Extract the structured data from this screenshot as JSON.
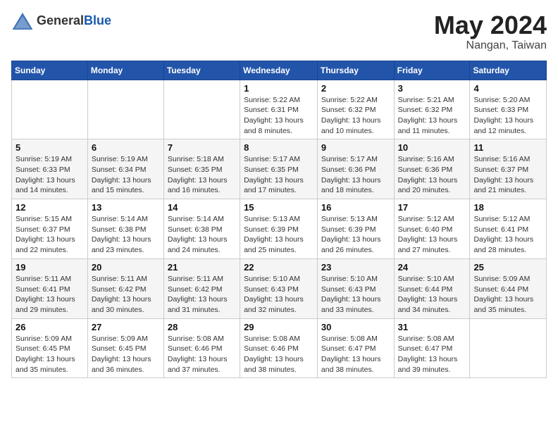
{
  "header": {
    "logo_general": "General",
    "logo_blue": "Blue",
    "month": "May 2024",
    "location": "Nangan, Taiwan"
  },
  "weekdays": [
    "Sunday",
    "Monday",
    "Tuesday",
    "Wednesday",
    "Thursday",
    "Friday",
    "Saturday"
  ],
  "weeks": [
    [
      {
        "day": "",
        "info": ""
      },
      {
        "day": "",
        "info": ""
      },
      {
        "day": "",
        "info": ""
      },
      {
        "day": "1",
        "info": "Sunrise: 5:22 AM\nSunset: 6:31 PM\nDaylight: 13 hours\nand 8 minutes."
      },
      {
        "day": "2",
        "info": "Sunrise: 5:22 AM\nSunset: 6:32 PM\nDaylight: 13 hours\nand 10 minutes."
      },
      {
        "day": "3",
        "info": "Sunrise: 5:21 AM\nSunset: 6:32 PM\nDaylight: 13 hours\nand 11 minutes."
      },
      {
        "day": "4",
        "info": "Sunrise: 5:20 AM\nSunset: 6:33 PM\nDaylight: 13 hours\nand 12 minutes."
      }
    ],
    [
      {
        "day": "5",
        "info": "Sunrise: 5:19 AM\nSunset: 6:33 PM\nDaylight: 13 hours\nand 14 minutes."
      },
      {
        "day": "6",
        "info": "Sunrise: 5:19 AM\nSunset: 6:34 PM\nDaylight: 13 hours\nand 15 minutes."
      },
      {
        "day": "7",
        "info": "Sunrise: 5:18 AM\nSunset: 6:35 PM\nDaylight: 13 hours\nand 16 minutes."
      },
      {
        "day": "8",
        "info": "Sunrise: 5:17 AM\nSunset: 6:35 PM\nDaylight: 13 hours\nand 17 minutes."
      },
      {
        "day": "9",
        "info": "Sunrise: 5:17 AM\nSunset: 6:36 PM\nDaylight: 13 hours\nand 18 minutes."
      },
      {
        "day": "10",
        "info": "Sunrise: 5:16 AM\nSunset: 6:36 PM\nDaylight: 13 hours\nand 20 minutes."
      },
      {
        "day": "11",
        "info": "Sunrise: 5:16 AM\nSunset: 6:37 PM\nDaylight: 13 hours\nand 21 minutes."
      }
    ],
    [
      {
        "day": "12",
        "info": "Sunrise: 5:15 AM\nSunset: 6:37 PM\nDaylight: 13 hours\nand 22 minutes."
      },
      {
        "day": "13",
        "info": "Sunrise: 5:14 AM\nSunset: 6:38 PM\nDaylight: 13 hours\nand 23 minutes."
      },
      {
        "day": "14",
        "info": "Sunrise: 5:14 AM\nSunset: 6:38 PM\nDaylight: 13 hours\nand 24 minutes."
      },
      {
        "day": "15",
        "info": "Sunrise: 5:13 AM\nSunset: 6:39 PM\nDaylight: 13 hours\nand 25 minutes."
      },
      {
        "day": "16",
        "info": "Sunrise: 5:13 AM\nSunset: 6:39 PM\nDaylight: 13 hours\nand 26 minutes."
      },
      {
        "day": "17",
        "info": "Sunrise: 5:12 AM\nSunset: 6:40 PM\nDaylight: 13 hours\nand 27 minutes."
      },
      {
        "day": "18",
        "info": "Sunrise: 5:12 AM\nSunset: 6:41 PM\nDaylight: 13 hours\nand 28 minutes."
      }
    ],
    [
      {
        "day": "19",
        "info": "Sunrise: 5:11 AM\nSunset: 6:41 PM\nDaylight: 13 hours\nand 29 minutes."
      },
      {
        "day": "20",
        "info": "Sunrise: 5:11 AM\nSunset: 6:42 PM\nDaylight: 13 hours\nand 30 minutes."
      },
      {
        "day": "21",
        "info": "Sunrise: 5:11 AM\nSunset: 6:42 PM\nDaylight: 13 hours\nand 31 minutes."
      },
      {
        "day": "22",
        "info": "Sunrise: 5:10 AM\nSunset: 6:43 PM\nDaylight: 13 hours\nand 32 minutes."
      },
      {
        "day": "23",
        "info": "Sunrise: 5:10 AM\nSunset: 6:43 PM\nDaylight: 13 hours\nand 33 minutes."
      },
      {
        "day": "24",
        "info": "Sunrise: 5:10 AM\nSunset: 6:44 PM\nDaylight: 13 hours\nand 34 minutes."
      },
      {
        "day": "25",
        "info": "Sunrise: 5:09 AM\nSunset: 6:44 PM\nDaylight: 13 hours\nand 35 minutes."
      }
    ],
    [
      {
        "day": "26",
        "info": "Sunrise: 5:09 AM\nSunset: 6:45 PM\nDaylight: 13 hours\nand 35 minutes."
      },
      {
        "day": "27",
        "info": "Sunrise: 5:09 AM\nSunset: 6:45 PM\nDaylight: 13 hours\nand 36 minutes."
      },
      {
        "day": "28",
        "info": "Sunrise: 5:08 AM\nSunset: 6:46 PM\nDaylight: 13 hours\nand 37 minutes."
      },
      {
        "day": "29",
        "info": "Sunrise: 5:08 AM\nSunset: 6:46 PM\nDaylight: 13 hours\nand 38 minutes."
      },
      {
        "day": "30",
        "info": "Sunrise: 5:08 AM\nSunset: 6:47 PM\nDaylight: 13 hours\nand 38 minutes."
      },
      {
        "day": "31",
        "info": "Sunrise: 5:08 AM\nSunset: 6:47 PM\nDaylight: 13 hours\nand 39 minutes."
      },
      {
        "day": "",
        "info": ""
      }
    ]
  ]
}
